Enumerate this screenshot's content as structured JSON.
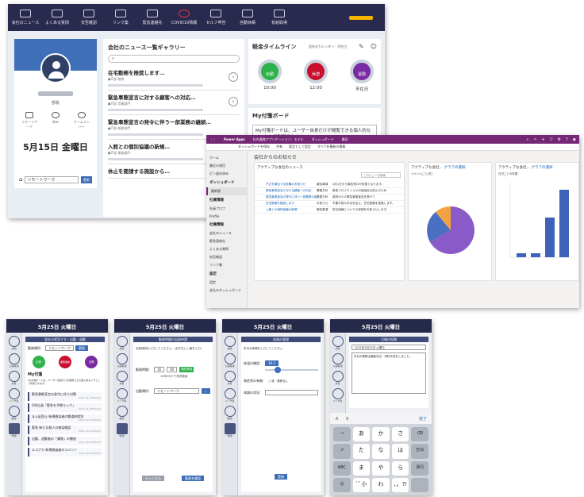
{
  "portal": {
    "nav": [
      {
        "label": "会社のニュース"
      },
      {
        "label": "よくある質問"
      },
      {
        "label": "安否確認"
      },
      {
        "label": "リンク集"
      },
      {
        "label": "緊急連絡先"
      },
      {
        "label": "COVID19情報"
      },
      {
        "label": "セルフ申告"
      },
      {
        "label": "自動休暇"
      },
      {
        "label": "有給取得"
      }
    ],
    "profile": {
      "title": "部長",
      "icons": [
        "リモートワーク",
        "休み",
        "チームメンバー"
      ],
      "date": "5月15日 金曜日",
      "footer_select": "リモートワーク",
      "footer_button": "更新"
    },
    "gallery": {
      "title": "会社のニュース一覧ギャラリー",
      "search_placeholder": "",
      "items": [
        {
          "title": "在宅勤務を推奨します…",
          "meta": "●IT部 総務"
        },
        {
          "title": "緊急事態宣言に対する顧客への対応…",
          "meta": "●IT部 営業部門"
        },
        {
          "title": "緊急事態宣言の発令に伴う一部業務の継続…",
          "meta": "●IT部 総務部門"
        },
        {
          "title": "入館との個別協議の新規…",
          "meta": "●IT部 業務部門"
        },
        {
          "title": "休止を要請する施設から…",
          "meta": ""
        }
      ]
    },
    "timeline": {
      "title": "軽金タイムライン",
      "subtitle": "会社のカレンダー：不在日",
      "items": [
        {
          "label": "出勤",
          "time": "10:00",
          "color": "#2db34a"
        },
        {
          "label": "休憩",
          "time": "12:00",
          "color": "#c8102e"
        },
        {
          "label": "退勤",
          "time": "不在日",
          "color": "#7a2aa3"
        }
      ]
    },
    "mytask": {
      "title": "My付箋ボード",
      "text": "My付箋ボードは、ユーザー自身だけが閲覧できる個人的なメモとして利用できます。"
    }
  },
  "power_apps": {
    "topbar": [
      "Power Apps",
      "社内連絡アプリケーション：モデル",
      "ダッシュボード",
      "最初"
    ],
    "commands": [
      "ダッシュボードを保存",
      "共有",
      "既定として設定",
      "すべてを最新の情報"
    ],
    "nav": [
      {
        "label": "ホーム",
        "type": "item"
      },
      {
        "label": "最近の項目",
        "type": "item"
      },
      {
        "label": "ピン留め済み",
        "type": "item"
      },
      {
        "label": "ダッシュボード",
        "type": "header"
      },
      {
        "label": "最新版",
        "type": "item"
      },
      {
        "label": "社員情報",
        "type": "header"
      },
      {
        "label": "社員プロフ",
        "type": "item"
      },
      {
        "label": "Profile",
        "type": "item"
      },
      {
        "label": "社員情報",
        "type": "header"
      },
      {
        "label": "会社のニュース",
        "type": "item"
      },
      {
        "label": "緊急連絡先",
        "type": "item"
      },
      {
        "label": "よくある質問",
        "type": "item"
      },
      {
        "label": "安否確認",
        "type": "item"
      },
      {
        "label": "リンク集",
        "type": "item"
      },
      {
        "label": "設定",
        "type": "header"
      },
      {
        "label": "設定",
        "type": "item"
      },
      {
        "label": "会社のダッシュボード",
        "type": "item"
      }
    ],
    "title": "会社からのお知らせ",
    "card1": {
      "title": "アクティブな会社のニュース",
      "search": "このビューを検索"
    },
    "rows": [
      {
        "c1": "不正を報告する役職のお知らせ",
        "c2": "報告事項",
        "c3": "4月1日から報告窓口が変更となります。"
      },
      {
        "c1": "緊急事態宣言に対する顧客への対応",
        "c2": "業務方針",
        "c3": "新型コロナウイルスの感染拡大防止のため"
      },
      {
        "c1": "緊急事態宣言の発令に伴う一部業務の継続",
        "c2": "業務方針",
        "c3": "政府からの緊急事態宣言を受けて"
      },
      {
        "c1": "在宅勤務を推奨します",
        "c2": "お知らせ",
        "c3": "不要不急の外出を控え、在宅勤務を推奨します。"
      },
      {
        "c1": "入館との個別協議の新規",
        "c2": "報告事項",
        "c3": "防災訓練についての詳細をお知らせします。"
      }
    ],
    "card2": {
      "title": "アクティブな会社…",
      "tab": "グラフの選択",
      "subtitle": "ジャンルごと(件)",
      "legend": [
        "業務方針",
        "お知らせ",
        "報告事項",
        "リモートワーク"
      ]
    },
    "card3": {
      "title": "アクティブな会社…",
      "tab": "グラフの選択",
      "subtitle": "日付ごとの件数"
    },
    "bar_labels": [
      "27 2020",
      "29 2020",
      "30 2020",
      "31 2020"
    ],
    "bar_values": [
      1,
      1,
      10,
      17
    ],
    "pie_values": [
      45,
      35,
      20,
      10
    ]
  },
  "phones": {
    "date": "5月25日 火曜日",
    "sidebar": [
      "出勤",
      "公開情報",
      "共有",
      "リンク集",
      "確認",
      "申請"
    ],
    "phone1": {
      "sub": "会社の状況です・出勤・退勤",
      "status_label": "勤務場所：",
      "status_value": "リモートワーク",
      "button": "更新",
      "circles": [
        "出勤",
        "業務開始",
        "出勤"
      ],
      "board_title": "My付箋",
      "board_text": "My付箋ボードは、ユーザー自身だけが閲覧できる個人的なメモとして利用できます。",
      "news": [
        {
          "title": "緊急事態宣言の発令に伴う対策",
          "date": "2021-01-23T00:00"
        },
        {
          "title": "GW企画「緊急を予期ラック」",
          "date": "2021-01-26T00:00"
        },
        {
          "title": "まん延防止 新規感染者の都道府県別",
          "date": "2021-02-15T00:00"
        },
        {
          "title": "緊急 新たな個人の感染確認",
          "date": "2021-03-01T00:00"
        },
        {
          "title": "出勤、退勤者の「業務」の徹底",
          "date": "2021-03-10T00:00"
        },
        {
          "title": "エコアカ 新規感染者のコメント",
          "date": "2021-03-18T00:00"
        }
      ]
    },
    "phone2": {
      "sub": "勤務時間の記録申請",
      "notice": "出勤時刻を入力してください。(必ず正しい値を入力)",
      "time_label": "勤務時間：",
      "hour": "16",
      "minute": "00",
      "now_button": "現在時刻",
      "hint": "10時30分 午前勤務者",
      "place_label": "出勤場所：",
      "place_value": "リモートワーク",
      "cancel": "キャンセル",
      "submit": "勤務を確認"
    },
    "phone3": {
      "sub": "体調の管理",
      "notice": "本日の体調を入力してください。",
      "q1": "体温の確認：",
      "temp": "36.2",
      "q2": "咳症状の有無：",
      "q2_opt": "○ 咳・発熱なし",
      "q3": "体調の状況：",
      "submit": "登録"
    },
    "phone4": {
      "sub": "日報の投稿",
      "f1": "2021年5月25日 火曜日",
      "f2": "本日の業務は顧客対応・資料作成をしました。",
      "done": "完了",
      "keys": [
        "→",
        "あ",
        "か",
        "さ",
        "⌫",
        "↺",
        "た",
        "な",
        "は",
        "空白",
        "ABC",
        "ま",
        "や",
        "ら",
        "改行",
        "☺",
        "ﾞﾟ小",
        "わ",
        "、。?!",
        ""
      ]
    }
  }
}
